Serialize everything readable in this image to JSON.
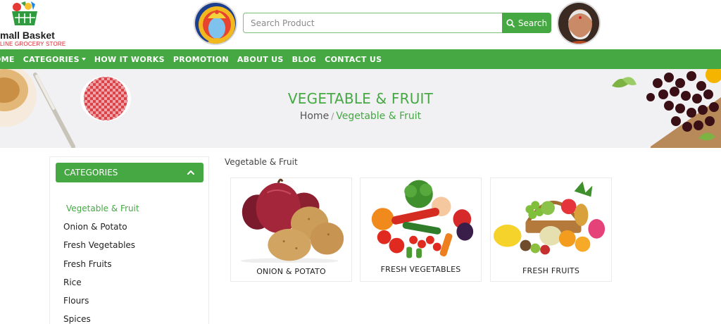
{
  "header": {
    "brand": "mall Basket",
    "tagline": "LINE GROCERY STORE",
    "search": {
      "placeholder": "Search Product",
      "button_label": "Search"
    },
    "icons": [
      "basket-logo-icon",
      "search-icon"
    ]
  },
  "nav": {
    "items": [
      "OME",
      "CATEGORIES",
      "HOW IT WORKS",
      "PROMOTION",
      "ABOUT US",
      "BLOG",
      "CONTACT US"
    ]
  },
  "banner": {
    "title": "VEGETABLE & FRUIT",
    "breadcrumb": {
      "home": "Home",
      "separator": "/",
      "current": "Vegetable & Fruit"
    }
  },
  "sidebar": {
    "heading": "CATEGORIES",
    "items": [
      "Vegetable & Fruit",
      "Onion & Potato",
      "Fresh Vegetables",
      "Fresh Fruits",
      "Rice",
      "Flours",
      "Spices"
    ],
    "active_index": 0
  },
  "main": {
    "section_label": "Vegetable & Fruit",
    "cards": [
      {
        "label": "ONION & POTATO"
      },
      {
        "label": "FRESH VEGETABLES"
      },
      {
        "label": "FRESH FRUITS"
      }
    ]
  },
  "colors": {
    "accent": "#45a843",
    "tagline": "#d8262e",
    "banner_bg": "#f1f1f4"
  }
}
